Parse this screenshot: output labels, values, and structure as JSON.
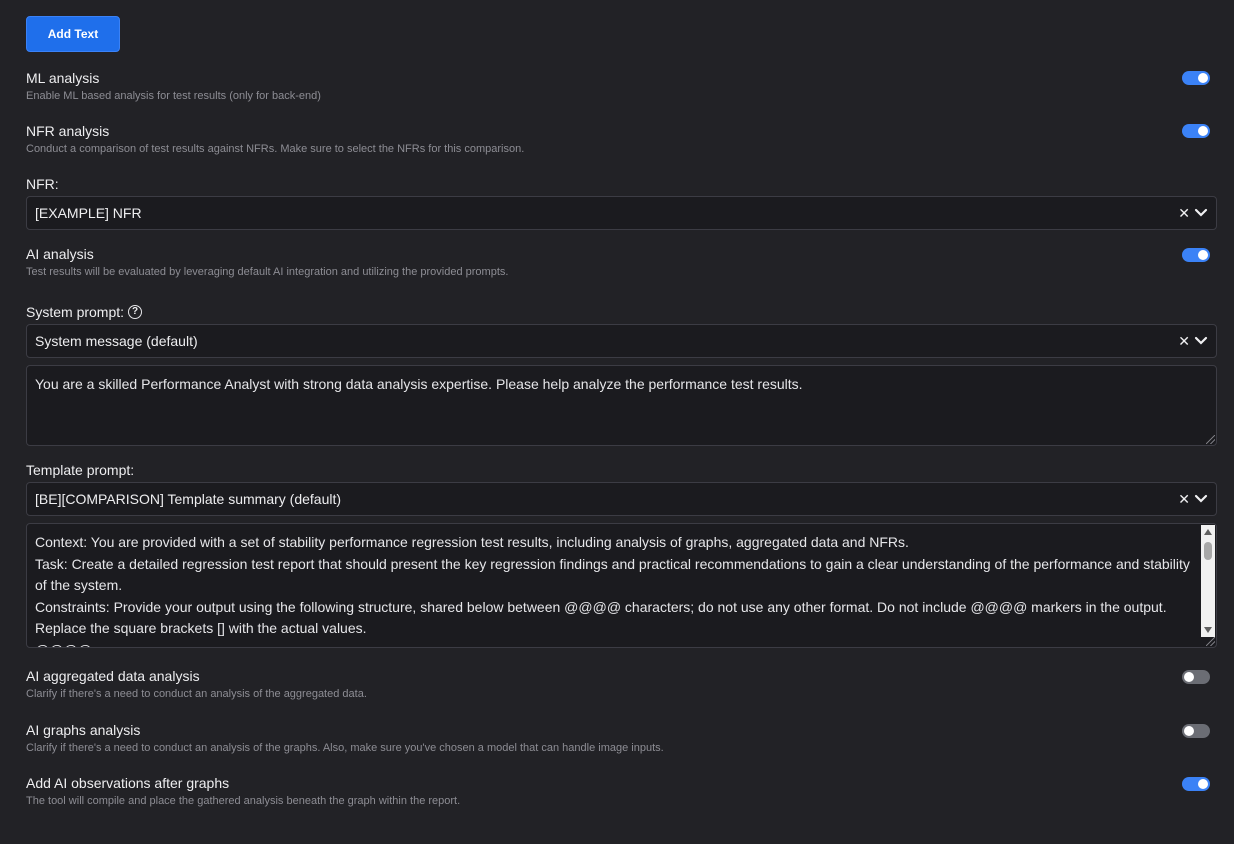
{
  "add_button": {
    "label": "Add Text"
  },
  "settings": {
    "ml_analysis": {
      "title": "ML analysis",
      "desc": "Enable ML based analysis for test results (only for back-end)",
      "enabled": true
    },
    "nfr_analysis": {
      "title": "NFR analysis",
      "desc": "Conduct a comparison of test results against NFRs. Make sure to select the NFRs for this comparison.",
      "enabled": true
    },
    "ai_analysis": {
      "title": "AI analysis",
      "desc": "Test results will be evaluated by leveraging default AI integration and utilizing the provided prompts.",
      "enabled": true
    },
    "ai_aggregated": {
      "title": "AI aggregated data analysis",
      "desc": "Clarify if there's a need to conduct an analysis of the aggregated data.",
      "enabled": false
    },
    "ai_graphs": {
      "title": "AI graphs analysis",
      "desc": "Clarify if there's a need to conduct an analysis of the graphs. Also, make sure you've chosen a model that can handle image inputs.",
      "enabled": false
    },
    "ai_observations": {
      "title": "Add AI observations after graphs",
      "desc": "The tool will compile and place the gathered analysis beneath the graph within the report.",
      "enabled": true
    }
  },
  "nfr": {
    "label": "NFR:",
    "value": "[EXAMPLE] NFR"
  },
  "system_prompt": {
    "label": "System prompt:",
    "help_icon": "question-circle-icon",
    "select_value": "System message (default)",
    "text": "You are a skilled Performance Analyst with strong data analysis expertise. Please help analyze the performance test results."
  },
  "template_prompt": {
    "label": "Template prompt:",
    "select_value": "[BE][COMPARISON] Template summary (default)",
    "text": "Context: You are provided with a set of stability performance regression test results, including analysis of graphs, aggregated data and NFRs.\nTask: Create a detailed regression test report that should present the key regression findings and practical recommendations to gain a clear understanding of the performance and stability of the system.\nConstraints: Provide your output using the following structure, shared below between @@@@ characters; do not use any other format. Do not include @@@@ markers in the output. Replace the square brackets [] with the actual values.\n@@@@"
  },
  "icons": {
    "clear": "×",
    "chevron": "chevron-down-icon"
  },
  "colors": {
    "accent": "#3b82f6",
    "background": "#222226",
    "field": "#1b1b1f"
  }
}
